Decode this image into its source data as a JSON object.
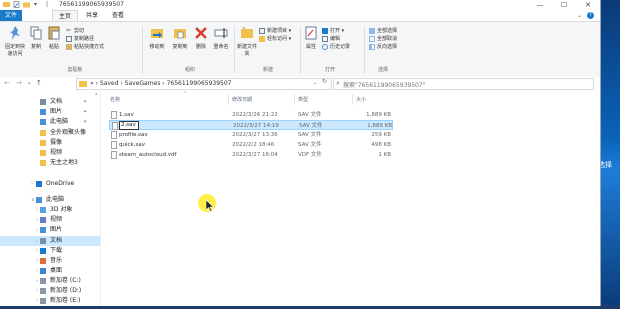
{
  "window": {
    "title": "76561199065939507",
    "controls": {
      "minimize": "—",
      "maximize": "☐",
      "close": "✕"
    }
  },
  "tabs": {
    "file": "文件",
    "home": "主页",
    "share": "共享",
    "view": "查看"
  },
  "ribbon": {
    "clipboard": {
      "pin": "固定到快速访问",
      "copy": "复制",
      "paste": "粘贴",
      "cut": "剪切",
      "copy_path": "复制路径",
      "paste_shortcut": "粘贴快捷方式",
      "label": "剪贴板"
    },
    "organize": {
      "move_to": "移动到",
      "copy_to": "复制到",
      "delete": "删除",
      "rename": "重命名",
      "label": "组织"
    },
    "new": {
      "new_folder": "新建文件夹",
      "new_item": "新建项目",
      "easy_access": "轻松访问",
      "label": "新建"
    },
    "open": {
      "properties": "属性",
      "open": "打开",
      "edit": "编辑",
      "history": "历史记录",
      "label": "打开"
    },
    "select": {
      "select_all": "全部选择",
      "select_none": "全部取消",
      "invert": "反向选择",
      "label": "选择"
    }
  },
  "address": {
    "segments": [
      "Saved",
      "SaveGames",
      "76561199065939507"
    ],
    "prefix": "«",
    "search_placeholder": "搜索\"76561199065939507\""
  },
  "nav": {
    "items": [
      {
        "label": "文档",
        "icon": "documents-icon",
        "pinned": true
      },
      {
        "label": "图片",
        "icon": "pictures-icon",
        "pinned": true
      },
      {
        "label": "此电脑",
        "icon": "this-pc-icon",
        "pinned": true
      },
      {
        "label": "全外观聚头像",
        "icon": "folder-icon",
        "pinned": false
      },
      {
        "label": "摄像",
        "icon": "folder-icon",
        "pinned": false
      },
      {
        "label": "视频",
        "icon": "folder-icon",
        "pinned": false
      },
      {
        "label": "无主之地3",
        "icon": "folder-icon",
        "pinned": false
      },
      {
        "label": "OneDrive",
        "icon": "onedrive-icon",
        "pinned": false
      },
      {
        "label": "此电脑",
        "icon": "this-pc-icon",
        "pinned": false
      },
      {
        "label": "3D 对象",
        "icon": "3d-objects-icon",
        "pinned": false
      },
      {
        "label": "视频",
        "icon": "videos-icon",
        "pinned": false
      },
      {
        "label": "图片",
        "icon": "pictures-icon",
        "pinned": false
      },
      {
        "label": "文档",
        "icon": "documents-icon",
        "pinned": false
      },
      {
        "label": "下载",
        "icon": "downloads-icon",
        "pinned": false
      },
      {
        "label": "音乐",
        "icon": "music-icon",
        "pinned": false
      },
      {
        "label": "桌面",
        "icon": "desktop-icon",
        "pinned": false
      },
      {
        "label": "新加卷 (C:)",
        "icon": "drive-icon",
        "pinned": false
      },
      {
        "label": "新加卷 (D:)",
        "icon": "drive-icon",
        "pinned": false
      },
      {
        "label": "新加卷 (E:)",
        "icon": "drive-icon",
        "pinned": false
      }
    ],
    "selected_index": 12
  },
  "columns": {
    "name": "名称",
    "date": "修改日期",
    "type": "类型",
    "size": "大小"
  },
  "files": [
    {
      "name": "1.sav",
      "date": "2022/3/26 21:22",
      "type": "SAV 文件",
      "size": "1,889 KB"
    },
    {
      "name": "2.sav",
      "date": "2022/3/27 14:19",
      "type": "SAV 文件",
      "size": "1,889 KB",
      "renaming": true
    },
    {
      "name": "profile.sav",
      "date": "2022/3/27 13:36",
      "type": "SAV 文件",
      "size": "259 KB"
    },
    {
      "name": "quick.sav",
      "date": "2022/2/2 18:46",
      "type": "SAV 文件",
      "size": "498 KB"
    },
    {
      "name": "steam_autocloud.vdf",
      "date": "2022/3/27 16:04",
      "type": "VDF 文件",
      "size": "1 KB"
    }
  ],
  "peek_text": "选择",
  "colors": {
    "accent": "#1979ca",
    "selection": "#cce8ff",
    "folder": "#f2c04c",
    "delete_red": "#d83b2d"
  }
}
